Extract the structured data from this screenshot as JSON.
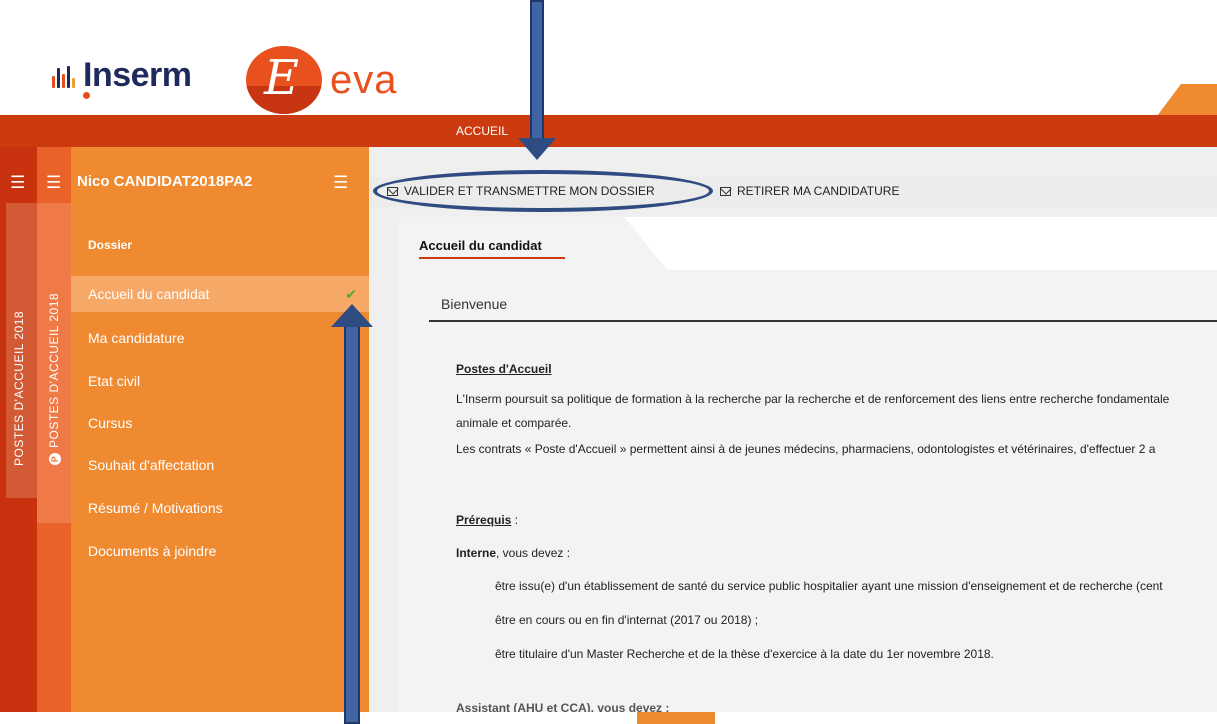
{
  "header": {
    "inserm_label": "Inserm",
    "eva_label": "eva",
    "eva_initial": "E"
  },
  "navbar": {
    "accueil_label": "ACCUEIL"
  },
  "rails": {
    "rail1_label": "POSTES D'ACCUEIL 2018",
    "rail2_label": "POSTES D'ACCUEIL 2018",
    "rail2_badge": "P"
  },
  "sidebar": {
    "user_name": "Nico CANDIDAT2018PA2",
    "section_title": "Dossier",
    "items": [
      {
        "label": "Accueil du candidat",
        "active": true
      },
      {
        "label": "Ma candidature"
      },
      {
        "label": "Etat civil"
      },
      {
        "label": "Cursus"
      },
      {
        "label": "Souhait d'affectation"
      },
      {
        "label": "Résumé / Motivations"
      },
      {
        "label": "Documents à joindre"
      }
    ],
    "check_icon": "✔"
  },
  "toolbar": {
    "validate_label": "VALIDER ET TRANSMETTRE MON DOSSIER",
    "withdraw_label": "RETIRER MA CANDIDATURE"
  },
  "content": {
    "tab_label": "Accueil du candidat",
    "welcome": "Bienvenue",
    "section1_title": "Postes d'Accueil",
    "p1_line1": "L'Inserm poursuit sa politique de formation à la recherche par la recherche et de renforcement des liens entre recherche fondamentale",
    "p1_line2": "animale et comparée.",
    "p2": "Les contrats « Poste d'Accueil » permettent ainsi à de jeunes médecins, pharmaciens, odontologistes et vétérinaires, d'effectuer 2 a",
    "prereq_title": "Prérequis",
    "prereq_colon": " :",
    "interne_bold": "Interne",
    "interne_rest": ", vous devez :",
    "bullet1": "être issu(e) d'un établissement de santé du service public hospitalier ayant une mission d'enseignement et de recherche (cent",
    "bullet2": "être en cours ou en fin d'internat (2017 ou 2018) ;",
    "bullet3": "être titulaire d'un Master Recherche et de la thèse d'exercice à la date du 1er novembre 2018.",
    "cut_line": "Assistant (AHU et CCA), vous devez :"
  },
  "colors": {
    "nav_red": "#cc3a10",
    "sidebar_orange": "#f08a30",
    "arrow_blue": "#3f63a3",
    "check_green": "#5aa53a"
  }
}
